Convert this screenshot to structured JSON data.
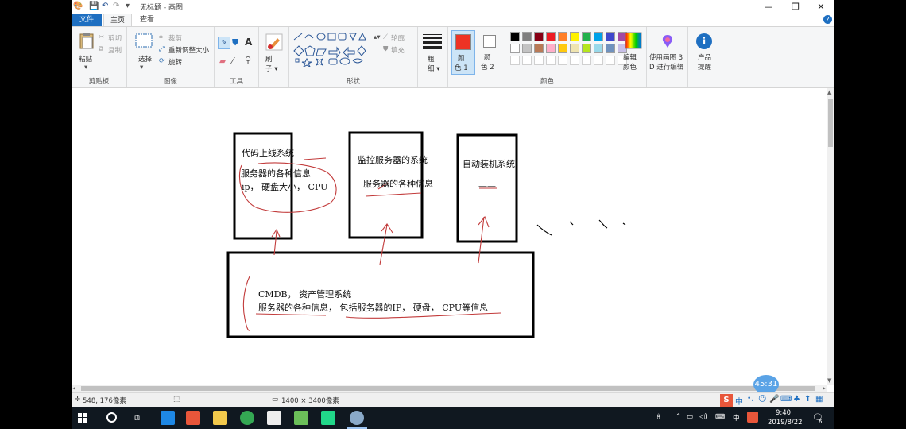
{
  "titlebar": {
    "title": "无标题 - 画图",
    "minimize": "—",
    "maximize": "❐",
    "close": "✕"
  },
  "tabs": {
    "file": "文件",
    "home": "主页",
    "view": "查看"
  },
  "ribbon": {
    "clipboard": {
      "paste": "粘贴",
      "cut": "剪切",
      "copy": "复制",
      "label": "剪贴板"
    },
    "image": {
      "select": "选择",
      "crop": "裁剪",
      "resize": "重新调整大小",
      "rotate": "旋转",
      "label": "图像"
    },
    "tools": {
      "label": "工具"
    },
    "brushes": {
      "label": "刷子"
    },
    "shapes": {
      "outline": "轮廓",
      "fill": "填充",
      "label": "形状"
    },
    "size": {
      "label": "粗细"
    },
    "colors": {
      "color1": "颜色 1",
      "color2": "颜色 2",
      "edit": "编辑颜色",
      "label": "颜色",
      "color1_value": "#ee3324",
      "color2_value": "#ffffff",
      "palette_row1": [
        "#000000",
        "#7f7f7f",
        "#880015",
        "#ed1c24",
        "#ff7f27",
        "#fff200",
        "#22b14c",
        "#00a2e8",
        "#3f48cc",
        "#a349a4"
      ],
      "palette_row2": [
        "#ffffff",
        "#c3c3c3",
        "#b97a57",
        "#ffaec9",
        "#ffc90e",
        "#efe4b0",
        "#b5e61d",
        "#99d9ea",
        "#7092be",
        "#c8bfe7"
      ]
    },
    "paint3d": "使用画图 3D 进行编辑",
    "product_alert": "产品提醒"
  },
  "drawing": {
    "box1": {
      "title": "代码上线系统",
      "line1": "服务器的各种信息",
      "line2": "ip， 硬盘大小， CPU"
    },
    "box2": {
      "title": "监控服务器的系统",
      "line1": "服务器的各种信息"
    },
    "box3": {
      "title": "自动装机系统",
      "dash": "——"
    },
    "cmdb": {
      "line1": "CMDB， 资产管理系统",
      "line2": "服务器的各种信息， 包括服务器的IP， 硬盘， CPU等信息"
    }
  },
  "timer": "45:31",
  "status": {
    "cursor": "548, 176像素",
    "size": "1400 × 3400像素"
  },
  "taskbar": {
    "time": "9:40",
    "date": "2019/8/22",
    "ime": "中",
    "notif_count": "6"
  }
}
